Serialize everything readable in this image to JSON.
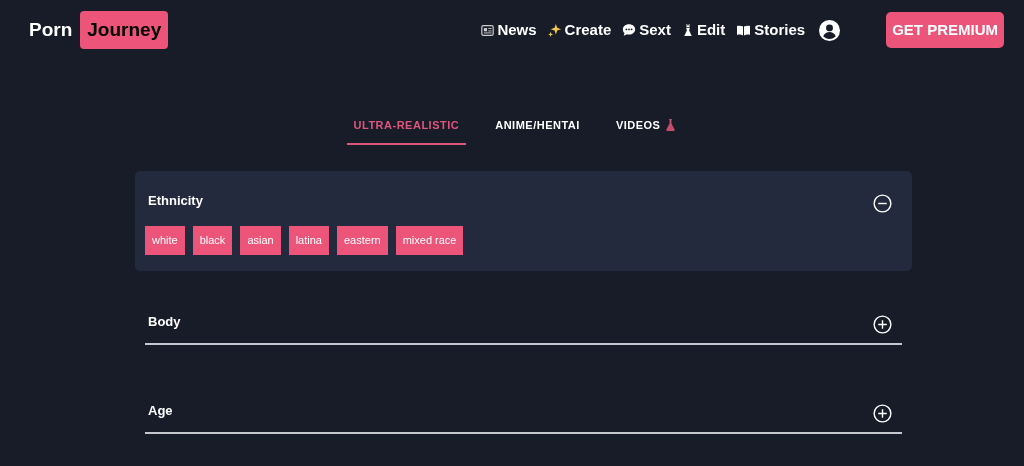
{
  "logo": {
    "first": "Porn",
    "second": "Journey"
  },
  "nav": [
    {
      "label": "News"
    },
    {
      "label": "Create"
    },
    {
      "label": "Sext"
    },
    {
      "label": "Edit"
    },
    {
      "label": "Stories"
    }
  ],
  "premium_button": "GET PREMIUM",
  "tabs": [
    {
      "label": "ULTRA-REALISTIC",
      "selected": true
    },
    {
      "label": "ANIME/HENTAI",
      "selected": false
    },
    {
      "label": "VIDEOS",
      "selected": false
    }
  ],
  "sections": [
    {
      "title": "Ethnicity",
      "expanded": true,
      "tags": [
        "white",
        "black",
        "asian",
        "latina",
        "eastern",
        "mixed race"
      ]
    },
    {
      "title": "Body",
      "expanded": false
    },
    {
      "title": "Age",
      "expanded": false
    }
  ]
}
